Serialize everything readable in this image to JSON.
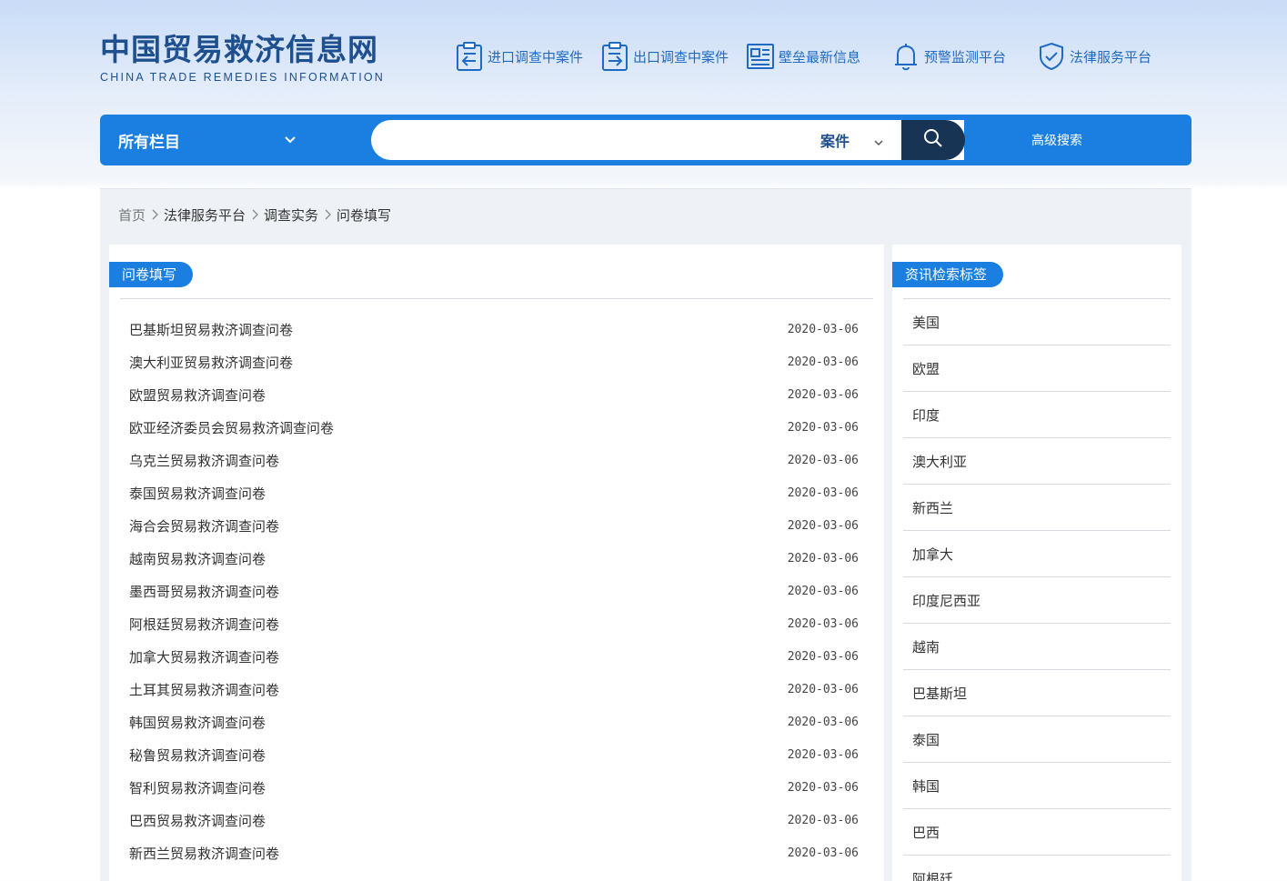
{
  "header": {
    "logo_cn": "中国贸易救济信息网",
    "logo_en": "CHINA TRADE REMEDIES INFORMATION",
    "nav": [
      {
        "label": "进口调查中案件",
        "icon": "import-clipboard-icon"
      },
      {
        "label": "出口调查中案件",
        "icon": "export-clipboard-icon"
      },
      {
        "label": "壁垒最新信息",
        "icon": "news-icon"
      },
      {
        "label": "预警监测平台",
        "icon": "bell-icon"
      },
      {
        "label": "法律服务平台",
        "icon": "shield-check-icon"
      }
    ]
  },
  "search": {
    "category_label": "所有栏目",
    "query_value": "",
    "type_label": "案件",
    "advanced_label": "高级搜索"
  },
  "breadcrumb": [
    "首页",
    "法律服务平台",
    "调查实务",
    "问卷填写"
  ],
  "main": {
    "section_title": "问卷填写",
    "articles": [
      {
        "title": "巴基斯坦贸易救济调查问卷",
        "date": "2020-03-06"
      },
      {
        "title": "澳大利亚贸易救济调查问卷",
        "date": "2020-03-06"
      },
      {
        "title": "欧盟贸易救济调查问卷",
        "date": "2020-03-06"
      },
      {
        "title": "欧亚经济委员会贸易救济调查问卷",
        "date": "2020-03-06"
      },
      {
        "title": "乌克兰贸易救济调查问卷",
        "date": "2020-03-06"
      },
      {
        "title": "泰国贸易救济调查问卷",
        "date": "2020-03-06"
      },
      {
        "title": "海合会贸易救济调查问卷",
        "date": "2020-03-06"
      },
      {
        "title": "越南贸易救济调查问卷",
        "date": "2020-03-06"
      },
      {
        "title": "墨西哥贸易救济调查问卷",
        "date": "2020-03-06"
      },
      {
        "title": "阿根廷贸易救济调查问卷",
        "date": "2020-03-06"
      },
      {
        "title": "加拿大贸易救济调查问卷",
        "date": "2020-03-06"
      },
      {
        "title": "土耳其贸易救济调查问卷",
        "date": "2020-03-06"
      },
      {
        "title": "韩国贸易救济调查问卷",
        "date": "2020-03-06"
      },
      {
        "title": "秘鲁贸易救济调查问卷",
        "date": "2020-03-06"
      },
      {
        "title": "智利贸易救济调查问卷",
        "date": "2020-03-06"
      },
      {
        "title": "巴西贸易救济调查问卷",
        "date": "2020-03-06"
      },
      {
        "title": "新西兰贸易救济调查问卷",
        "date": "2020-03-06"
      }
    ]
  },
  "sidebar": {
    "title": "资讯检索标签",
    "tags": [
      "美国",
      "欧盟",
      "印度",
      "澳大利亚",
      "新西兰",
      "加拿大",
      "印度尼西亚",
      "越南",
      "巴基斯坦",
      "泰国",
      "韩国",
      "巴西",
      "阿根廷"
    ]
  },
  "colors": {
    "accent": "#1a7fe0",
    "logo": "#1e4f8e",
    "nav_text": "#1f6bc4",
    "search_button": "#173455"
  }
}
